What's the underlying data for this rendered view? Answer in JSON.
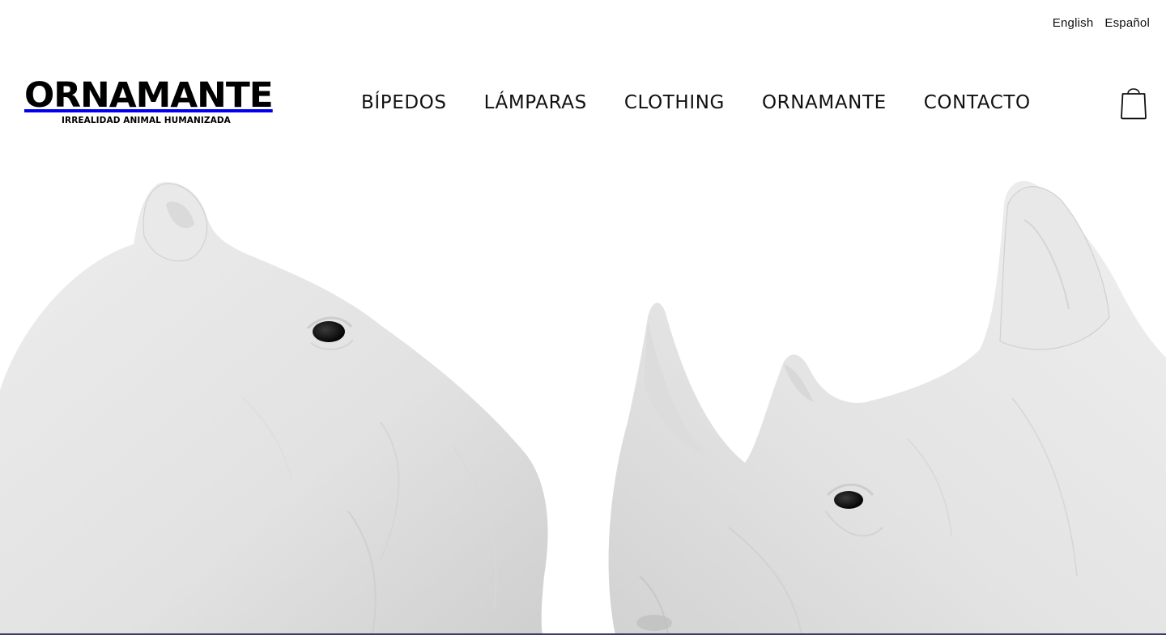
{
  "language_switcher": {
    "english": "English",
    "spanish": "Español"
  },
  "brand": {
    "logo_text": "ORNAMANTE",
    "tagline": "IRREALIDAD ANIMAL HUMANIZADA"
  },
  "nav": {
    "items": [
      {
        "label": "BÍPEDOS"
      },
      {
        "label": "LÁMPARAS"
      },
      {
        "label": "CLOTHING"
      },
      {
        "label": "ORNAMANTE"
      },
      {
        "label": "CONTACTO"
      }
    ]
  },
  "cart": {
    "icon": "shopping-bag-icon"
  },
  "hero": {
    "image": "hippo-and-rhino-white-sculptures"
  },
  "colors": {
    "text": "#111111",
    "background": "#ffffff",
    "sculpture": "#e6e6e6"
  }
}
